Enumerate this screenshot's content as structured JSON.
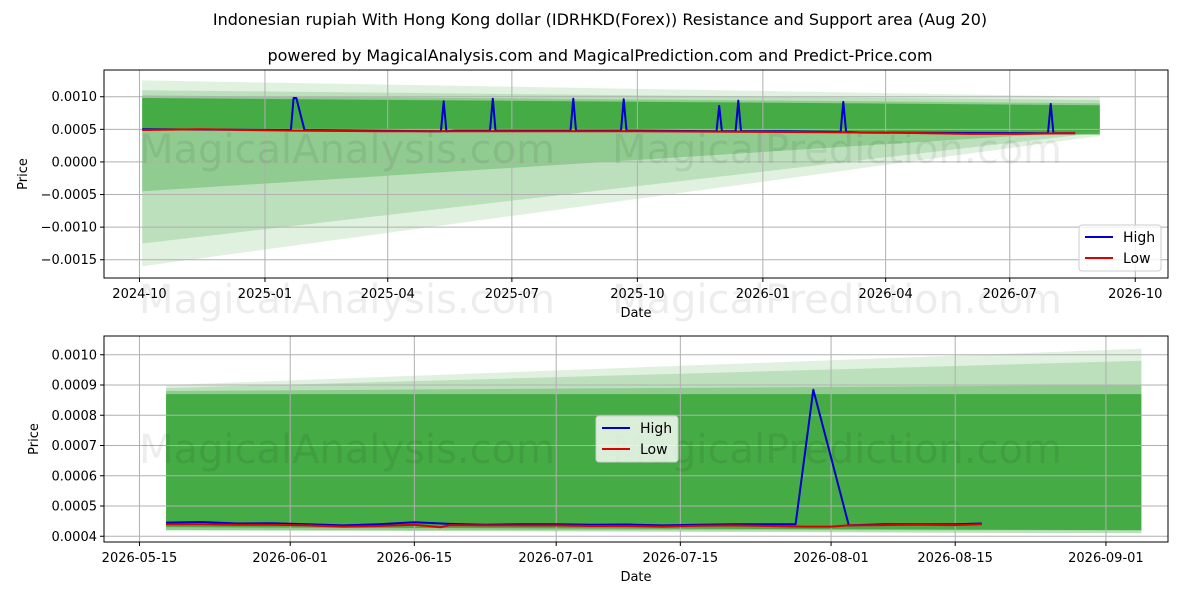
{
  "header": {
    "title": "Indonesian rupiah With Hong Kong dollar (IDRHKD(Forex)) Resistance and Support area (Aug 20)",
    "subtitle": "powered by MagicalAnalysis.com and MagicalPrediction.com and Predict-Price.com"
  },
  "watermark": {
    "left": "MagicalAnalysis.com",
    "right": "MagicalPrediction.com"
  },
  "colors": {
    "high": "#0000cc",
    "low": "#dd0000",
    "band": "#2ca02c",
    "grid": "#b0b0b0"
  },
  "chart_data": [
    {
      "type": "line",
      "xlabel": "Date",
      "ylabel": "Price",
      "x_ticks": [
        "2024-10",
        "2025-01",
        "2025-04",
        "2025-07",
        "2025-10",
        "2026-01",
        "2026-04",
        "2026-07",
        "2026-10"
      ],
      "y_ticks": [
        "0.0010",
        "0.0005",
        "0.0000",
        "−0.0005",
        "−0.0010",
        "−0.0015"
      ],
      "xlim": [
        "2024-09-05",
        "2026-10-25"
      ],
      "ylim": [
        -0.00178,
        0.00141
      ],
      "legend": {
        "position": "lower-right",
        "entries": [
          "High",
          "Low"
        ]
      },
      "grid": true,
      "bands": [
        {
          "x0": "2024-10-03",
          "x1": "2026-09-05",
          "upper": [
            0.00125,
            0.001
          ],
          "lower": [
            -0.0016,
            0.0004
          ],
          "opacity": 0.15
        },
        {
          "x0": "2024-10-03",
          "x1": "2026-09-05",
          "upper": [
            0.0011,
            0.00095
          ],
          "lower": [
            -0.00125,
            0.00045
          ],
          "opacity": 0.2
        },
        {
          "x0": "2024-10-03",
          "x1": "2026-09-05",
          "upper": [
            0.00102,
            0.0009
          ],
          "lower": [
            -0.00045,
            0.00048
          ],
          "opacity": 0.3
        },
        {
          "x0": "2024-10-03",
          "x1": "2026-09-05",
          "upper": [
            0.00098,
            0.00087
          ],
          "lower": [
            0.0005,
            0.00042
          ],
          "opacity": 0.75
        }
      ],
      "series": [
        {
          "name": "High",
          "x": [
            "2024-10-03",
            "2025-01-10",
            "2025-01-20",
            "2025-01-22",
            "2025-01-24",
            "2025-01-30",
            "2025-05-05",
            "2025-05-10",
            "2025-05-12",
            "2025-05-14",
            "2025-05-20",
            "2025-06-15",
            "2025-06-17",
            "2025-06-19",
            "2025-06-25",
            "2025-08-13",
            "2025-08-15",
            "2025-08-17",
            "2025-08-25",
            "2025-09-19",
            "2025-09-21",
            "2025-09-23",
            "2025-10-01",
            "2025-11-28",
            "2025-11-30",
            "2025-12-02",
            "2025-12-12",
            "2025-12-14",
            "2025-12-16",
            "2026-01-15",
            "2026-02-27",
            "2026-03-01",
            "2026-03-03",
            "2026-03-15",
            "2026-07-29",
            "2026-07-31",
            "2026-08-02",
            "2026-08-18"
          ],
          "values": [
            0.0005,
            0.00049,
            0.00049,
            0.00098,
            0.00098,
            0.00049,
            0.00047,
            0.00047,
            0.00093,
            0.00047,
            0.00048,
            0.00048,
            0.00097,
            0.00048,
            0.00048,
            0.00048,
            0.00097,
            0.00048,
            0.00048,
            0.00048,
            0.00096,
            0.00048,
            0.00048,
            0.00047,
            0.00086,
            0.00047,
            0.00047,
            0.00094,
            0.00047,
            0.00047,
            0.00046,
            0.00092,
            0.00046,
            0.00045,
            0.00044,
            0.00089,
            0.00044,
            0.00044
          ]
        },
        {
          "name": "Low",
          "x": [
            "2024-10-03",
            "2024-11-15",
            "2025-01-20",
            "2025-04-01",
            "2025-07-01",
            "2025-10-01",
            "2026-01-01",
            "2026-04-01",
            "2026-06-01",
            "2026-07-01",
            "2026-08-18"
          ],
          "values": [
            0.00049,
            0.0005,
            0.00048,
            0.00047,
            0.00047,
            0.00047,
            0.00046,
            0.00045,
            0.00043,
            0.00043,
            0.00044
          ]
        }
      ]
    },
    {
      "type": "line",
      "xlabel": "Date",
      "ylabel": "Price",
      "x_ticks": [
        "2026-05-15",
        "2026-06-01",
        "2026-06-15",
        "2026-07-01",
        "2026-07-15",
        "2026-08-01",
        "2026-08-15",
        "2026-09-01"
      ],
      "y_ticks": [
        "0.0010",
        "0.0009",
        "0.0008",
        "0.0007",
        "0.0006",
        "0.0005",
        "0.0004"
      ],
      "xlim": [
        "2026-05-11",
        "2026-09-08"
      ],
      "ylim": [
        0.000381,
        0.001062
      ],
      "legend": {
        "position": "center",
        "entries": [
          "High",
          "Low"
        ]
      },
      "grid": true,
      "bands": [
        {
          "x0": "2026-05-18",
          "x1": "2026-09-05",
          "upper": [
            0.0009,
            0.00102
          ],
          "lower": [
            0.00042,
            0.00041
          ],
          "opacity": 0.15
        },
        {
          "x0": "2026-05-18",
          "x1": "2026-09-05",
          "upper": [
            0.00089,
            0.00098
          ],
          "lower": [
            0.00042,
            0.00041
          ],
          "opacity": 0.2
        },
        {
          "x0": "2026-05-18",
          "x1": "2026-09-05",
          "upper": [
            0.00088,
            0.0009
          ],
          "lower": [
            0.00042,
            0.00042
          ],
          "opacity": 0.3
        },
        {
          "x0": "2026-05-18",
          "x1": "2026-09-05",
          "upper": [
            0.00087,
            0.00087
          ],
          "lower": [
            0.00043,
            0.00042
          ],
          "opacity": 0.75
        }
      ],
      "series": [
        {
          "name": "High",
          "x": [
            "2026-05-18",
            "2026-05-22",
            "2026-05-26",
            "2026-05-30",
            "2026-06-03",
            "2026-06-07",
            "2026-06-11",
            "2026-06-15",
            "2026-06-19",
            "2026-06-23",
            "2026-06-27",
            "2026-07-01",
            "2026-07-05",
            "2026-07-09",
            "2026-07-13",
            "2026-07-17",
            "2026-07-21",
            "2026-07-25",
            "2026-07-28",
            "2026-07-30",
            "2026-08-01",
            "2026-08-03",
            "2026-08-07",
            "2026-08-11",
            "2026-08-15",
            "2026-08-18"
          ],
          "values": [
            0.000445,
            0.000447,
            0.000442,
            0.000443,
            0.00044,
            0.000436,
            0.00044,
            0.000446,
            0.000441,
            0.000438,
            0.00044,
            0.00044,
            0.000438,
            0.000439,
            0.000436,
            0.000438,
            0.00044,
            0.00044,
            0.00044,
            0.000884,
            0.00066,
            0.000436,
            0.00044,
            0.00044,
            0.00044,
            0.000442
          ]
        },
        {
          "name": "Low",
          "x": [
            "2026-05-18",
            "2026-05-22",
            "2026-05-26",
            "2026-05-30",
            "2026-06-03",
            "2026-06-07",
            "2026-06-11",
            "2026-06-15",
            "2026-06-18",
            "2026-06-19",
            "2026-06-23",
            "2026-06-27",
            "2026-07-01",
            "2026-07-05",
            "2026-07-09",
            "2026-07-13",
            "2026-07-17",
            "2026-07-21",
            "2026-07-25",
            "2026-07-29",
            "2026-08-01",
            "2026-08-03",
            "2026-08-07",
            "2026-08-11",
            "2026-08-15",
            "2026-08-18"
          ],
          "values": [
            0.00044,
            0.00044,
            0.000438,
            0.000438,
            0.000436,
            0.000432,
            0.000434,
            0.000438,
            0.00043,
            0.000437,
            0.000436,
            0.000436,
            0.000436,
            0.000434,
            0.000434,
            0.000432,
            0.000435,
            0.000436,
            0.000434,
            0.000432,
            0.000432,
            0.000436,
            0.000437,
            0.000438,
            0.000437,
            0.00044
          ]
        }
      ]
    }
  ]
}
